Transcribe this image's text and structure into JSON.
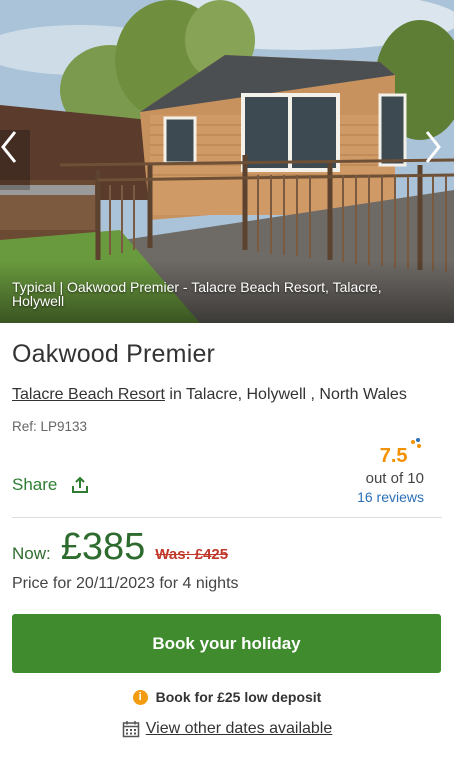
{
  "hero": {
    "caption": "Typical | Oakwood Premier - Talacre Beach Resort, Talacre, Holywell",
    "prev_icon": "chevron-left-icon",
    "next_icon": "chevron-right-icon"
  },
  "property": {
    "title": "Oakwood Premier",
    "resort_link": "Talacre Beach Resort",
    "location_text": " in Talacre, Holywell , North Wales",
    "ref": "Ref: LP9133"
  },
  "share": {
    "label": "Share",
    "icon": "share-upload-icon"
  },
  "rating": {
    "score": "7.5",
    "out_of": "out of 10",
    "reviews": "16 reviews"
  },
  "price": {
    "now_label": "Now:",
    "amount": "£385",
    "was": "Was: £425",
    "price_for": "Price for 20/11/2023 for 4 nights"
  },
  "book": {
    "label": "Book your holiday"
  },
  "deposit": {
    "label": "Book for £25 low deposit",
    "icon": "info-icon"
  },
  "other_dates": {
    "label": "View other dates available",
    "icon": "calendar-icon"
  },
  "colors": {
    "accent_green": "#3f8b2e",
    "price_green": "#2e6b2e",
    "rating_orange": "#f39200",
    "link_blue": "#2c6fb7",
    "was_red": "#c0392b"
  }
}
